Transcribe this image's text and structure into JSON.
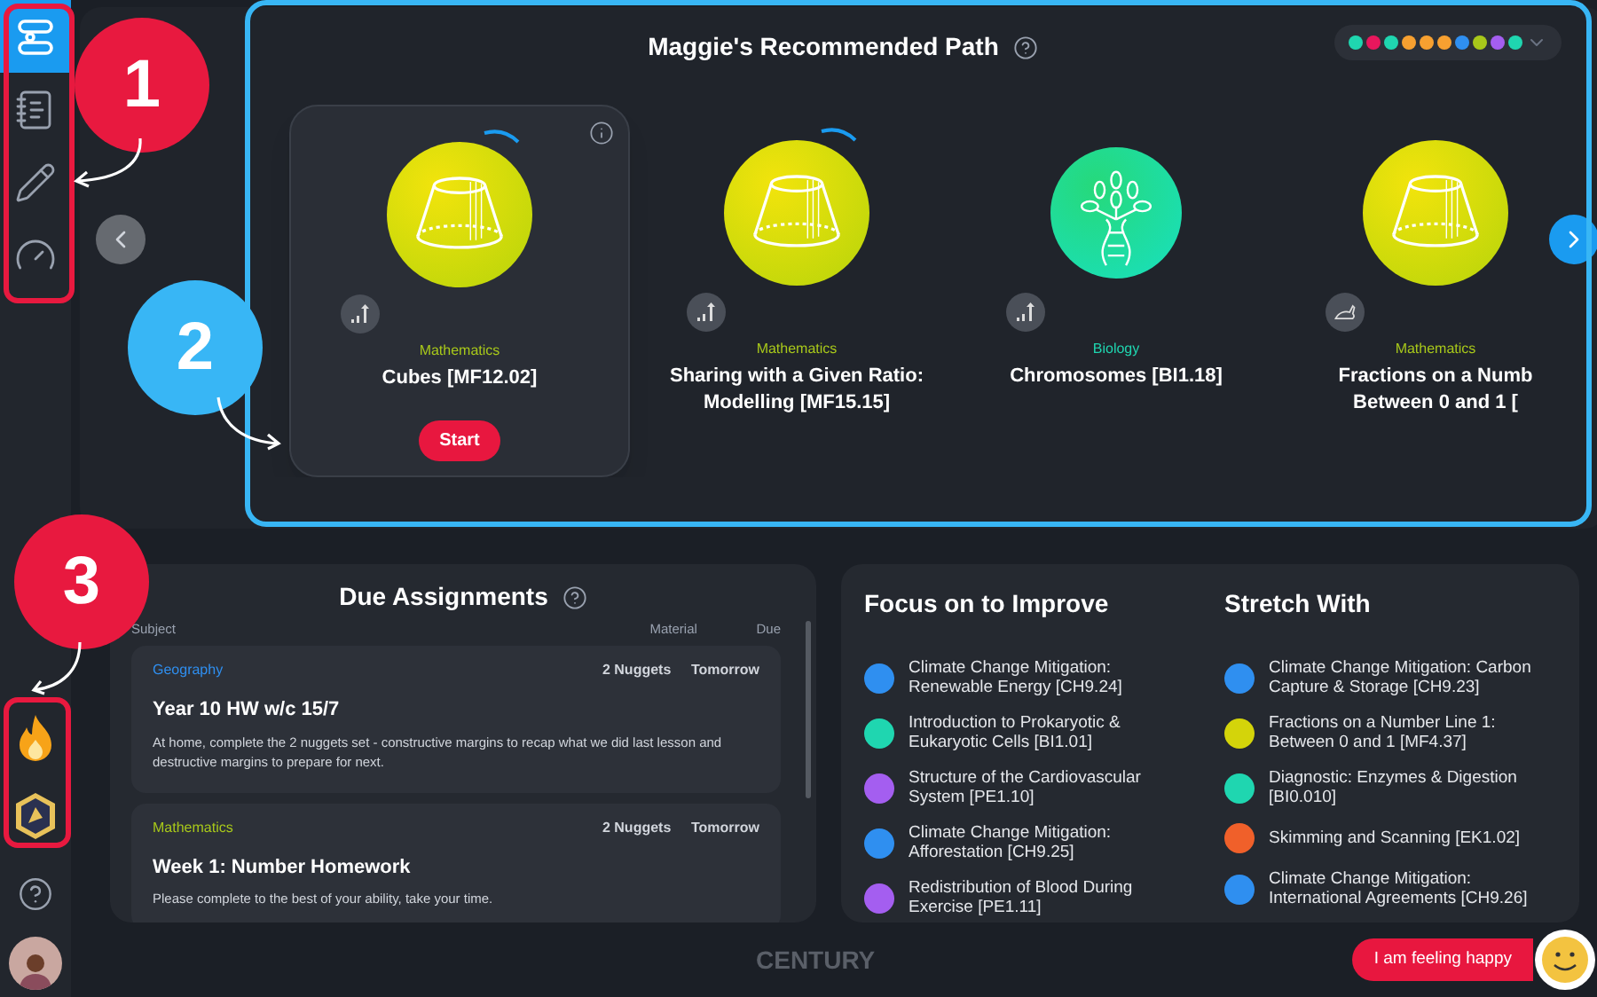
{
  "sidebar": {
    "items": [
      {
        "kind": "path",
        "selected": true
      },
      {
        "kind": "list",
        "selected": false
      },
      {
        "kind": "pencil",
        "selected": false
      },
      {
        "kind": "gauge",
        "selected": false
      }
    ],
    "bottom_items": [
      {
        "kind": "flame"
      },
      {
        "kind": "badge"
      },
      {
        "kind": "help"
      },
      {
        "kind": "avatar"
      }
    ]
  },
  "annotations": [
    {
      "number": "1",
      "color": "#e8193f"
    },
    {
      "number": "2",
      "color": "#38b6f5"
    },
    {
      "number": "3",
      "color": "#e8193f"
    }
  ],
  "recommended_path": {
    "title": "Maggie's Recommended Path",
    "filter_dots": [
      {
        "color": "#1fd6b0"
      },
      {
        "color": "#e8175d"
      },
      {
        "color": "#1fd6b0"
      },
      {
        "color": "#f7a030"
      },
      {
        "color": "#f7a030"
      },
      {
        "color": "#f7a030"
      },
      {
        "color": "#2f8ff0"
      },
      {
        "color": "#a8c81a"
      },
      {
        "color": "#a45ef0"
      },
      {
        "color": "#1fd6b0"
      }
    ],
    "items": [
      {
        "subject": "Mathematics",
        "color": "#a8c81a",
        "title": "Cubes [MF12.02]",
        "kind": "frustum",
        "fast_track": false,
        "in_progress": true,
        "selected": true,
        "action": "Start"
      },
      {
        "subject": "Mathematics",
        "color": "#a8c81a",
        "title": "Sharing with a Given Ratio: Modelling [MF15.15]",
        "kind": "frustum",
        "fast_track": false,
        "in_progress": true,
        "selected": false
      },
      {
        "subject": "Biology",
        "color": "#1fd6b0",
        "title": "Chromosomes [BI1.18]",
        "kind": "tree",
        "fast_track": false,
        "in_progress": false,
        "selected": false
      },
      {
        "subject": "Mathematics",
        "color": "#a8c81a",
        "title": "Fractions on a Numb Between 0 and 1 [",
        "kind": "frustum",
        "fast_track": true,
        "in_progress": false,
        "selected": false
      }
    ]
  },
  "due_assignments": {
    "title": "Due Assignments",
    "columns": [
      "Subject",
      "Material",
      "Due"
    ],
    "rows": [
      {
        "subject": "Geography",
        "color": "#2f8ff0",
        "material": "2 Nuggets",
        "due": "Tomorrow",
        "title": "Year 10 HW w/c 15/7",
        "description": "At home, complete the 2 nuggets set - constructive margins to recap what we did last lesson and destructive margins to prepare for next."
      },
      {
        "subject": "Mathematics",
        "color": "#a8c81a",
        "material": "2 Nuggets",
        "due": "Tomorrow",
        "title": "Week 1: Number Homework",
        "description": "Please complete to the best of your ability, take your time."
      }
    ]
  },
  "focus": {
    "title": "Focus on to Improve",
    "items": [
      {
        "text": "Climate Change Mitigation: Renewable Energy [CH9.24]",
        "color": "#2f8ff0"
      },
      {
        "text": "Introduction to Prokaryotic & Eukaryotic Cells [BI1.01]",
        "color": "#1fd6b0"
      },
      {
        "text": "Structure of the Cardiovascular System [PE1.10]",
        "color": "#a45ef0"
      },
      {
        "text": "Climate Change Mitigation: Afforestation [CH9.25]",
        "color": "#2f8ff0"
      },
      {
        "text": "Redistribution of Blood During Exercise [PE1.11]",
        "color": "#a45ef0"
      }
    ]
  },
  "stretch": {
    "title": "Stretch With",
    "items": [
      {
        "text": "Climate Change Mitigation: Carbon Capture & Storage [CH9.23]",
        "color": "#2f8ff0"
      },
      {
        "text": "Fractions on a Number Line 1: Between 0 and 1 [MF4.37]",
        "color": "#d4d40a"
      },
      {
        "text": "Diagnostic: Enzymes & Digestion [BI0.010]",
        "color": "#1fd6b0"
      },
      {
        "text": "Skimming and Scanning [EK1.02]",
        "color": "#f0602a"
      },
      {
        "text": "Climate Change Mitigation: International Agreements [CH9.26]",
        "color": "#2f8ff0"
      }
    ]
  },
  "footer": {
    "logo": "CENTURY",
    "mood_button": "I am feeling happy"
  }
}
